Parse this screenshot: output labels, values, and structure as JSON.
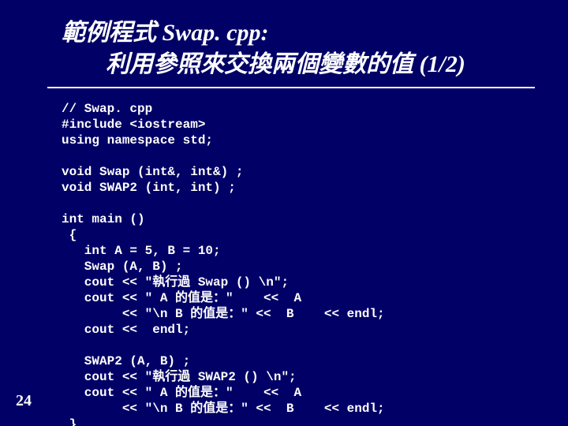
{
  "title": {
    "line1": "範例程式 Swap. cpp:",
    "line2": "利用參照來交換兩個變數的值 (1/2)"
  },
  "code": "// Swap. cpp\n#include <iostream>\nusing namespace std;\n\nvoid Swap (int&, int&) ;\nvoid SWAP2 (int, int) ;\n\nint main ()\n {\n   int A = 5, B = 10;\n   Swap (A, B) ;\n   cout << \"執行過 Swap () \\n\";\n   cout << \" A 的值是：\"    <<  A\n        << \"\\n B 的值是：\" <<  B    << endl;\n   cout <<  endl;\n\n   SWAP2 (A, B) ;\n   cout << \"執行過 SWAP2 () \\n\";\n   cout << \" A 的值是：\"    <<  A\n        << \"\\n B 的值是：\" <<  B    << endl;\n }",
  "page_number": "24"
}
